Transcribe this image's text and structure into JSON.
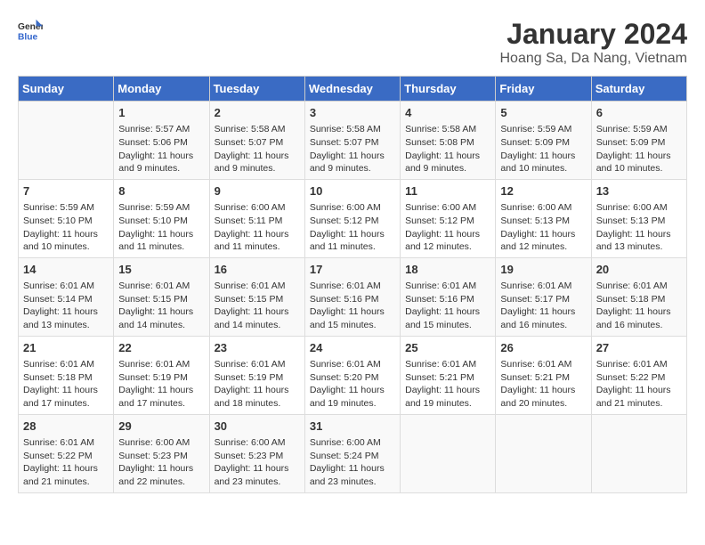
{
  "header": {
    "logo_general": "General",
    "logo_blue": "Blue",
    "title": "January 2024",
    "subtitle": "Hoang Sa, Da Nang, Vietnam"
  },
  "weekdays": [
    "Sunday",
    "Monday",
    "Tuesday",
    "Wednesday",
    "Thursday",
    "Friday",
    "Saturday"
  ],
  "weeks": [
    [
      {
        "day": "",
        "info": ""
      },
      {
        "day": "1",
        "info": "Sunrise: 5:57 AM\nSunset: 5:06 PM\nDaylight: 11 hours\nand 9 minutes."
      },
      {
        "day": "2",
        "info": "Sunrise: 5:58 AM\nSunset: 5:07 PM\nDaylight: 11 hours\nand 9 minutes."
      },
      {
        "day": "3",
        "info": "Sunrise: 5:58 AM\nSunset: 5:07 PM\nDaylight: 11 hours\nand 9 minutes."
      },
      {
        "day": "4",
        "info": "Sunrise: 5:58 AM\nSunset: 5:08 PM\nDaylight: 11 hours\nand 9 minutes."
      },
      {
        "day": "5",
        "info": "Sunrise: 5:59 AM\nSunset: 5:09 PM\nDaylight: 11 hours\nand 10 minutes."
      },
      {
        "day": "6",
        "info": "Sunrise: 5:59 AM\nSunset: 5:09 PM\nDaylight: 11 hours\nand 10 minutes."
      }
    ],
    [
      {
        "day": "7",
        "info": "Sunrise: 5:59 AM\nSunset: 5:10 PM\nDaylight: 11 hours\nand 10 minutes."
      },
      {
        "day": "8",
        "info": "Sunrise: 5:59 AM\nSunset: 5:10 PM\nDaylight: 11 hours\nand 11 minutes."
      },
      {
        "day": "9",
        "info": "Sunrise: 6:00 AM\nSunset: 5:11 PM\nDaylight: 11 hours\nand 11 minutes."
      },
      {
        "day": "10",
        "info": "Sunrise: 6:00 AM\nSunset: 5:12 PM\nDaylight: 11 hours\nand 11 minutes."
      },
      {
        "day": "11",
        "info": "Sunrise: 6:00 AM\nSunset: 5:12 PM\nDaylight: 11 hours\nand 12 minutes."
      },
      {
        "day": "12",
        "info": "Sunrise: 6:00 AM\nSunset: 5:13 PM\nDaylight: 11 hours\nand 12 minutes."
      },
      {
        "day": "13",
        "info": "Sunrise: 6:00 AM\nSunset: 5:13 PM\nDaylight: 11 hours\nand 13 minutes."
      }
    ],
    [
      {
        "day": "14",
        "info": "Sunrise: 6:01 AM\nSunset: 5:14 PM\nDaylight: 11 hours\nand 13 minutes."
      },
      {
        "day": "15",
        "info": "Sunrise: 6:01 AM\nSunset: 5:15 PM\nDaylight: 11 hours\nand 14 minutes."
      },
      {
        "day": "16",
        "info": "Sunrise: 6:01 AM\nSunset: 5:15 PM\nDaylight: 11 hours\nand 14 minutes."
      },
      {
        "day": "17",
        "info": "Sunrise: 6:01 AM\nSunset: 5:16 PM\nDaylight: 11 hours\nand 15 minutes."
      },
      {
        "day": "18",
        "info": "Sunrise: 6:01 AM\nSunset: 5:16 PM\nDaylight: 11 hours\nand 15 minutes."
      },
      {
        "day": "19",
        "info": "Sunrise: 6:01 AM\nSunset: 5:17 PM\nDaylight: 11 hours\nand 16 minutes."
      },
      {
        "day": "20",
        "info": "Sunrise: 6:01 AM\nSunset: 5:18 PM\nDaylight: 11 hours\nand 16 minutes."
      }
    ],
    [
      {
        "day": "21",
        "info": "Sunrise: 6:01 AM\nSunset: 5:18 PM\nDaylight: 11 hours\nand 17 minutes."
      },
      {
        "day": "22",
        "info": "Sunrise: 6:01 AM\nSunset: 5:19 PM\nDaylight: 11 hours\nand 17 minutes."
      },
      {
        "day": "23",
        "info": "Sunrise: 6:01 AM\nSunset: 5:19 PM\nDaylight: 11 hours\nand 18 minutes."
      },
      {
        "day": "24",
        "info": "Sunrise: 6:01 AM\nSunset: 5:20 PM\nDaylight: 11 hours\nand 19 minutes."
      },
      {
        "day": "25",
        "info": "Sunrise: 6:01 AM\nSunset: 5:21 PM\nDaylight: 11 hours\nand 19 minutes."
      },
      {
        "day": "26",
        "info": "Sunrise: 6:01 AM\nSunset: 5:21 PM\nDaylight: 11 hours\nand 20 minutes."
      },
      {
        "day": "27",
        "info": "Sunrise: 6:01 AM\nSunset: 5:22 PM\nDaylight: 11 hours\nand 21 minutes."
      }
    ],
    [
      {
        "day": "28",
        "info": "Sunrise: 6:01 AM\nSunset: 5:22 PM\nDaylight: 11 hours\nand 21 minutes."
      },
      {
        "day": "29",
        "info": "Sunrise: 6:00 AM\nSunset: 5:23 PM\nDaylight: 11 hours\nand 22 minutes."
      },
      {
        "day": "30",
        "info": "Sunrise: 6:00 AM\nSunset: 5:23 PM\nDaylight: 11 hours\nand 23 minutes."
      },
      {
        "day": "31",
        "info": "Sunrise: 6:00 AM\nSunset: 5:24 PM\nDaylight: 11 hours\nand 23 minutes."
      },
      {
        "day": "",
        "info": ""
      },
      {
        "day": "",
        "info": ""
      },
      {
        "day": "",
        "info": ""
      }
    ]
  ]
}
